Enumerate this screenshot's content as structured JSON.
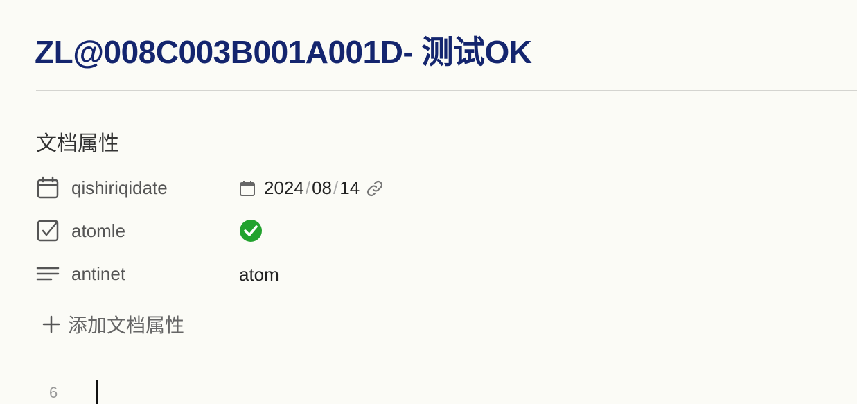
{
  "document": {
    "title": "ZL@008C003B001A001D- 测试OK"
  },
  "properties": {
    "heading": "文档属性",
    "items": [
      {
        "name": "qishiriqidate",
        "icon": "calendar-icon",
        "value": {
          "year": "2024",
          "month": "08",
          "day": "14",
          "separator": "/"
        }
      },
      {
        "name": "atomle",
        "icon": "checkbox-icon",
        "value_checked": true,
        "check_color": "#22a22e"
      },
      {
        "name": "antinet",
        "icon": "text-lines-icon",
        "value": "atom"
      }
    ],
    "add_label": "添加文档属性"
  },
  "editor": {
    "line_number": "6"
  },
  "colors": {
    "title": "#14256e",
    "background": "#fbfbf6",
    "check": "#22a22e"
  }
}
